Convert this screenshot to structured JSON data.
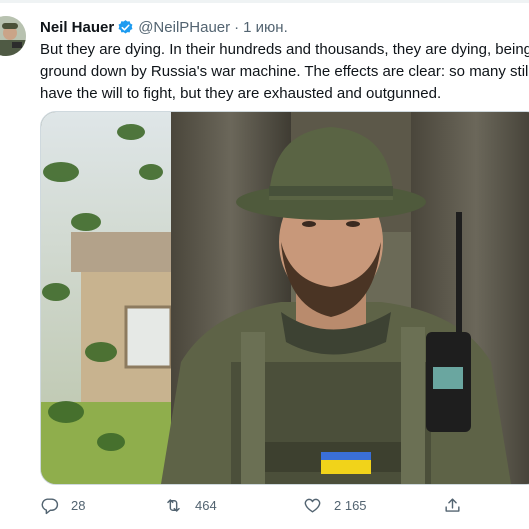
{
  "tweet": {
    "author_name": "Neil Hauer",
    "handle": "@NeilPHauer",
    "separator": "·",
    "date": "1 июн.",
    "text": "But they are dying. In their hundreds and thousands, they are dying, being\nground down by Russia's war machine. The effects are clear: so many still\nhave the will to fight, but they are exhausted and outgunned.",
    "verified": true
  },
  "actions": {
    "reply_count": "28",
    "retweet_count": "464",
    "like_count": "2 165"
  },
  "icons": {
    "verified": "verified-badge-icon",
    "reply": "reply-icon",
    "retweet": "retweet-icon",
    "like": "heart-icon",
    "share": "share-icon"
  },
  "colors": {
    "verified_blue": "#1d9bf0",
    "secondary_text": "#536471",
    "primary_text": "#0f1419"
  }
}
